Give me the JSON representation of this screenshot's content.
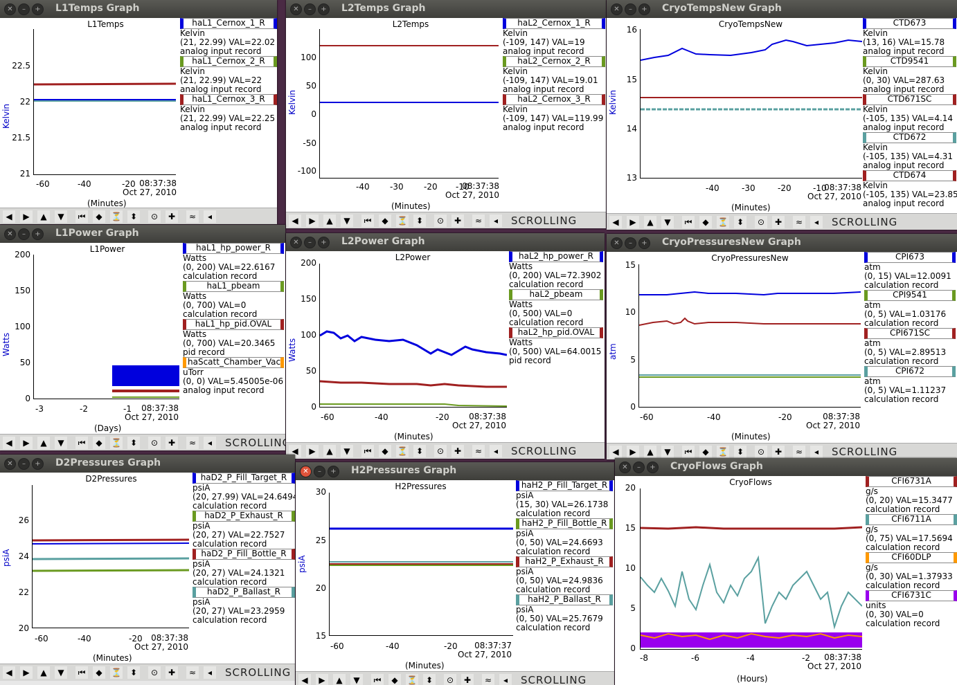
{
  "colors": {
    "blue": "#0000dd",
    "red": "#a02020",
    "cyan": "#5aa0a0",
    "green": "#6a9a20",
    "orange": "#ff9900",
    "purple": "#9900ee"
  },
  "toolbar": {
    "icons": [
      "◀",
      "▶",
      "▲",
      "▼",
      "⏮",
      "◆",
      "⏳",
      "⬍",
      "⊙",
      "✚",
      "≈",
      "◂"
    ],
    "scrolling": "SCROLLING"
  },
  "windows": [
    {
      "id": "l1temps",
      "title": "L1Temps Graph",
      "plot_title": "L1Temps",
      "ylabel": "Kelvin",
      "xunit": "(Minutes)",
      "yticks": [
        "22.5",
        "22",
        "21.5",
        "21"
      ],
      "xticks": [
        "-60",
        "-40",
        "-20"
      ],
      "stamp_time": "08:37:38",
      "stamp_date": "Oct 27, 2010",
      "legend": [
        {
          "name": "haL1_Cernox_1_R",
          "color": "blue",
          "lines": [
            "Kelvin",
            "(21, 22.99) VAL=22.02",
            "analog input record"
          ]
        },
        {
          "name": "haL1_Cernox_2_R",
          "color": "green",
          "lines": [
            "Kelvin",
            "(21, 22.99) VAL=22",
            "analog input record"
          ]
        },
        {
          "name": "haL1_Cernox_3_R",
          "color": "red",
          "lines": [
            "Kelvin",
            "(21, 22.99) VAL=22.25",
            "analog input record"
          ]
        }
      ]
    },
    {
      "id": "l2temps",
      "title": "L2Temps Graph",
      "plot_title": "L2Temps",
      "ylabel": "Kelvin",
      "xunit": "(Minutes)",
      "yticks": [
        "100",
        "50",
        "0",
        "-50",
        "-100"
      ],
      "xticks": [
        "-40",
        "-30",
        "-20",
        "-10"
      ],
      "stamp_time": "08:37:38",
      "stamp_date": "Oct 27, 2010",
      "scrolling": true,
      "legend": [
        {
          "name": "haL2_Cernox_1_R",
          "color": "blue",
          "lines": [
            "Kelvin",
            "(-109, 147) VAL=19",
            "analog input record"
          ]
        },
        {
          "name": "haL2_Cernox_2_R",
          "color": "green",
          "lines": [
            "Kelvin",
            "(-109, 147) VAL=19.01",
            "analog input record"
          ]
        },
        {
          "name": "haL2_Cernox_3_R",
          "color": "red",
          "lines": [
            "Kelvin",
            "(-109, 147) VAL=119.99",
            "analog input record"
          ]
        }
      ]
    },
    {
      "id": "cryotemps",
      "title": "CryoTempsNew Graph",
      "plot_title": "CryoTempsNew",
      "ylabel": "Kelvin",
      "xunit": "(Minutes)",
      "yticks": [
        "16",
        "15",
        "14",
        "13"
      ],
      "xticks": [
        "-40",
        "-30",
        "-20",
        "-10"
      ],
      "stamp_time": "08:37:38",
      "stamp_date": "Oct 27, 2010",
      "scrolling": true,
      "legend": [
        {
          "name": "CTD673",
          "color": "blue",
          "lines": [
            "Kelvin",
            "(13, 16) VAL=15.78",
            "analog input record"
          ]
        },
        {
          "name": "CTD9541",
          "color": "green",
          "lines": [
            "Kelvin",
            "(0, 30) VAL=287.63",
            "analog input record"
          ]
        },
        {
          "name": "CTD671SC",
          "color": "red",
          "lines": [
            "Kelvin",
            "(-105, 135) VAL=4.14",
            "analog input record"
          ]
        },
        {
          "name": "CTD672",
          "color": "cyan",
          "lines": [
            "Kelvin",
            "(-105, 135) VAL=4.31",
            "analog input record"
          ]
        },
        {
          "name": "CTD674",
          "color": "red",
          "lines": [
            "Kelvin",
            "(-105, 135) VAL=23.85",
            "analog input record"
          ]
        }
      ]
    },
    {
      "id": "l1power",
      "title": "L1Power Graph",
      "plot_title": "L1Power",
      "ylabel": "Watts",
      "xunit": "(Days)",
      "yticks": [
        "200",
        "150",
        "100",
        "50",
        "0"
      ],
      "xticks": [
        "-3",
        "-2",
        "-1"
      ],
      "stamp_time": "08:37:38",
      "stamp_date": "Oct 27, 2010",
      "scrolling": true,
      "legend": [
        {
          "name": "haL1_hp_power_R",
          "color": "blue",
          "lines": [
            "Watts",
            "(0, 200) VAL=22.6167",
            "calculation record"
          ]
        },
        {
          "name": "haL1_pbeam",
          "color": "green",
          "lines": [
            "Watts",
            "(0, 700) VAL=0",
            "calculation record"
          ]
        },
        {
          "name": "haL1_hp_pid.OVAL",
          "color": "red",
          "lines": [
            "Watts",
            "(0, 700) VAL=20.3465",
            "pid record"
          ]
        },
        {
          "name": "haScatt_Chamber_Vac_",
          "color": "orange",
          "lines": [
            "uTorr",
            "(0, 0) VAL=5.45005e-06",
            "analog input record"
          ]
        }
      ]
    },
    {
      "id": "l2power",
      "title": "L2Power Graph",
      "plot_title": "L2Power",
      "ylabel": "Watts",
      "xunit": "(Minutes)",
      "yticks": [
        "200",
        "150",
        "100",
        "50",
        "0"
      ],
      "xticks": [
        "-60",
        "-40",
        "-20"
      ],
      "stamp_time": "08:37:38",
      "stamp_date": "Oct 27, 2010",
      "scrolling": true,
      "legend": [
        {
          "name": "haL2_hp_power_R",
          "color": "blue",
          "lines": [
            "Watts",
            "(0, 200) VAL=72.3902",
            "calculation record"
          ]
        },
        {
          "name": "haL2_pbeam",
          "color": "green",
          "lines": [
            "Watts",
            "(0, 500) VAL=0",
            "calculation record"
          ]
        },
        {
          "name": "haL2_hp_pid.OVAL",
          "color": "red",
          "lines": [
            "Watts",
            "(0, 500) VAL=64.0015",
            "pid record"
          ]
        }
      ]
    },
    {
      "id": "cryopress",
      "title": "CryoPressuresNew Graph",
      "plot_title": "CryoPressuresNew",
      "ylabel": "atm",
      "xunit": "(Minutes)",
      "yticks": [
        "15",
        "10",
        "5",
        "0"
      ],
      "xticks": [
        "-60",
        "-40",
        "-20"
      ],
      "stamp_time": "08:37:38",
      "stamp_date": "Oct 27, 2010",
      "scrolling": true,
      "legend": [
        {
          "name": "CPI673",
          "color": "blue",
          "lines": [
            "atm",
            "(0, 15) VAL=12.0091",
            "calculation record"
          ]
        },
        {
          "name": "CPI9541",
          "color": "green",
          "lines": [
            "atm",
            "(0, 5) VAL=1.03176",
            "calculation record"
          ]
        },
        {
          "name": "CPI671SC",
          "color": "red",
          "lines": [
            "atm",
            "(0, 5) VAL=2.89513",
            "calculation record"
          ]
        },
        {
          "name": "CPI672",
          "color": "cyan",
          "lines": [
            "atm",
            "(0, 5) VAL=1.11237",
            "calculation record"
          ]
        }
      ]
    },
    {
      "id": "d2press",
      "title": "D2Pressures Graph",
      "plot_title": "D2Pressures",
      "ylabel": "psiA",
      "xunit": "(Minutes)",
      "yticks": [
        "26",
        "24",
        "22",
        "20"
      ],
      "xticks": [
        "-60",
        "-40",
        "-20"
      ],
      "stamp_time": "08:37:38",
      "stamp_date": "Oct 27, 2010",
      "scrolling": true,
      "legend": [
        {
          "name": "haD2_P_Fill_Target_R",
          "color": "blue",
          "lines": [
            "psiA",
            "(20, 27.99) VAL=24.6494",
            "calculation record"
          ]
        },
        {
          "name": "haD2_P_Exhaust_R",
          "color": "green",
          "lines": [
            "psiA",
            "(20, 27) VAL=22.7527",
            "calculation record"
          ]
        },
        {
          "name": "haD2_P_Fill_Bottle_R",
          "color": "red",
          "lines": [
            "psiA",
            "(20, 27) VAL=24.1321",
            "calculation record"
          ]
        },
        {
          "name": "haD2_P_Ballast_R",
          "color": "cyan",
          "lines": [
            "psiA",
            "(20, 27) VAL=23.2959",
            "calculation record"
          ]
        }
      ]
    },
    {
      "id": "h2press",
      "title": "H2Pressures Graph",
      "plot_title": "H2Pressures",
      "ylabel": "psiA",
      "xunit": "(Minutes)",
      "yticks": [
        "30",
        "25",
        "20",
        "15"
      ],
      "xticks": [
        "-60",
        "-40",
        "-20"
      ],
      "stamp_time": "08:37:37",
      "stamp_date": "Oct 27, 2010",
      "scrolling": true,
      "legend": [
        {
          "name": "haH2_P_Fill_Target_R",
          "color": "blue",
          "lines": [
            "psiA",
            "(15, 30) VAL=26.1738",
            "calculation record"
          ]
        },
        {
          "name": "haH2_P_Fill_Bottle_R",
          "color": "green",
          "lines": [
            "psiA",
            "(0, 50) VAL=24.6693",
            "calculation record"
          ]
        },
        {
          "name": "haH2_P_Exhaust_R",
          "color": "red",
          "lines": [
            "psiA",
            "(0, 50) VAL=24.9836",
            "calculation record"
          ]
        },
        {
          "name": "haH2_P_Ballast_R",
          "color": "cyan",
          "lines": [
            "psiA",
            "(0, 50) VAL=25.7679",
            "calculation record"
          ]
        }
      ]
    },
    {
      "id": "cryoflows",
      "title": "CryoFlows Graph",
      "plot_title": "CryoFlows",
      "ylabel": "",
      "xunit": "(Hours)",
      "yticks": [
        "20",
        "15",
        "10",
        "5",
        "0"
      ],
      "xticks": [
        "-8",
        "-6",
        "-4",
        "-2"
      ],
      "stamp_time": "08:37:38",
      "stamp_date": "Oct 27, 2010",
      "legend": [
        {
          "name": "CFI6731A",
          "color": "red",
          "lines": [
            "g/s",
            "(0, 20) VAL=15.3477",
            "calculation record"
          ]
        },
        {
          "name": "CFI6711A",
          "color": "cyan",
          "lines": [
            "g/s",
            "(0, 75) VAL=17.5694",
            "calculation record"
          ]
        },
        {
          "name": "CFI60DLP",
          "color": "orange",
          "lines": [
            "g/s",
            "(0, 30) VAL=1.37933",
            "calculation record"
          ]
        },
        {
          "name": "CFI6731C",
          "color": "purple",
          "lines": [
            "units",
            "(0, 30) VAL=0",
            "calculation record"
          ]
        }
      ]
    }
  ]
}
